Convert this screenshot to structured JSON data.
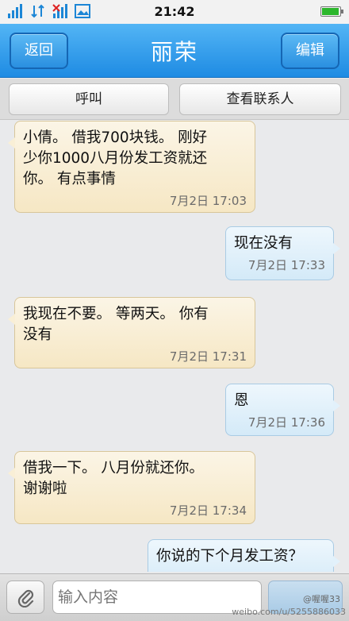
{
  "status_bar": {
    "time": "21:42",
    "icons": [
      "signal-icon",
      "data-transfer-icon",
      "signal-off-icon",
      "gallery-icon"
    ],
    "battery": {
      "level": 0.95,
      "color": "#2cb72c"
    }
  },
  "header": {
    "back_label": "返回",
    "title": "丽荣",
    "edit_label": "编辑",
    "colors": {
      "bar": "#2a93e6"
    }
  },
  "actions": {
    "call_label": "呼叫",
    "view_contact_label": "查看联系人"
  },
  "messages": [
    {
      "direction": "in",
      "lines": [
        "小倩。 借我700块钱。 刚好",
        "少你1000八月份发工资就还",
        "你。 有点事情"
      ],
      "time": "7月2日 17:03"
    },
    {
      "direction": "out",
      "lines": [
        "现在没有"
      ],
      "time": "7月2日 17:33"
    },
    {
      "direction": "in",
      "lines": [
        "我现在不要。 等两天。 你有",
        "没有"
      ],
      "time": "7月2日 17:31"
    },
    {
      "direction": "out",
      "lines": [
        "恩"
      ],
      "time": "7月2日 17:36"
    },
    {
      "direction": "in",
      "lines": [
        "借我一下。 八月份就还你。",
        "谢谢啦"
      ],
      "time": "7月2日 17:34"
    },
    {
      "direction": "out",
      "lines": [
        "你说的下个月发工资？"
      ],
      "time": ""
    }
  ],
  "input": {
    "placeholder": "输入内容",
    "value": ""
  },
  "watermark": {
    "handle": "@喔喔33",
    "url": "weibo.com/u/5255886033"
  }
}
